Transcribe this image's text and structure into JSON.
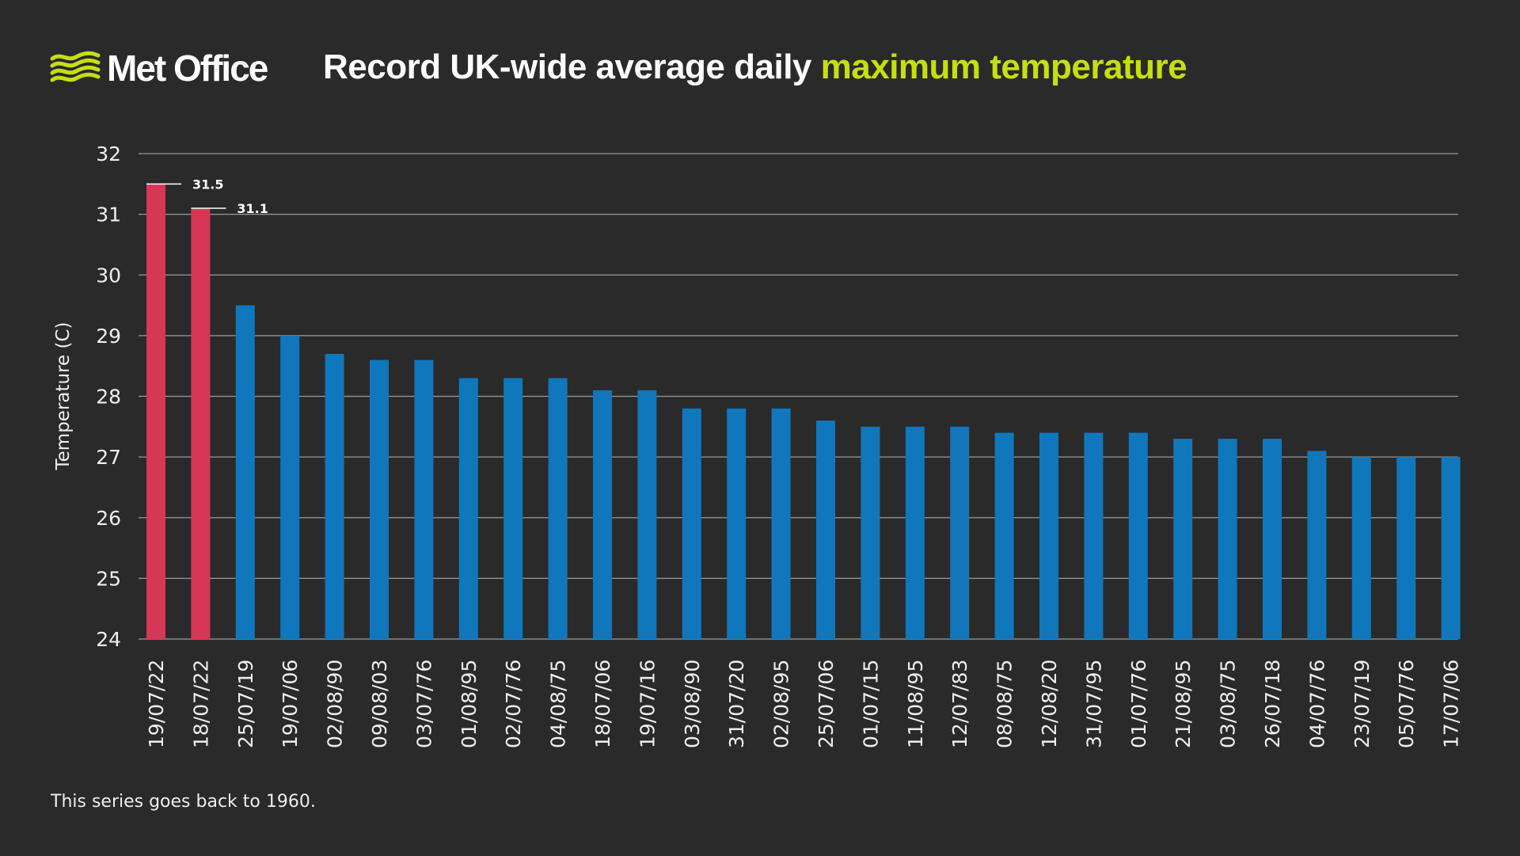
{
  "header": {
    "logo_text": "Met Office",
    "title_main": "Record UK-wide average daily",
    "title_accent": "maximum temperature"
  },
  "footer": {
    "note": "This series goes back to 1960."
  },
  "colors": {
    "background": "#2a2a2a",
    "accent": "#c4e00f",
    "record_bar": "#d63754",
    "bar": "#1077bc",
    "grid": "#9a9a9a",
    "text": "#ffffff"
  },
  "chart_data": {
    "type": "bar",
    "title": "Record UK-wide average daily maximum temperature",
    "xlabel": "",
    "ylabel": "Temperature (C)",
    "ylim": [
      24,
      32
    ],
    "yticks": [
      24,
      25,
      26,
      27,
      28,
      29,
      30,
      31,
      32
    ],
    "grid": true,
    "categories": [
      "19/07/22",
      "18/07/22",
      "25/07/19",
      "19/07/06",
      "02/08/90",
      "09/08/03",
      "03/07/76",
      "01/08/95",
      "02/07/76",
      "04/08/75",
      "18/07/06",
      "19/07/16",
      "03/08/90",
      "31/07/20",
      "02/08/95",
      "25/07/06",
      "01/07/15",
      "11/08/95",
      "12/07/83",
      "08/08/75",
      "12/08/20",
      "31/07/95",
      "01/07/76",
      "21/08/95",
      "03/08/75",
      "26/07/18",
      "04/07/76",
      "23/07/19",
      "05/07/76",
      "17/07/06"
    ],
    "values": [
      31.5,
      31.1,
      29.5,
      29.0,
      28.7,
      28.6,
      28.6,
      28.3,
      28.3,
      28.3,
      28.1,
      28.1,
      27.8,
      27.8,
      27.8,
      27.6,
      27.5,
      27.5,
      27.5,
      27.4,
      27.4,
      27.4,
      27.4,
      27.3,
      27.3,
      27.3,
      27.1,
      27.0,
      27.0,
      27.0
    ],
    "highlighted": [
      0,
      1
    ],
    "annotations": [
      {
        "index": 0,
        "text": "31.5"
      },
      {
        "index": 1,
        "text": "31.1"
      }
    ]
  }
}
